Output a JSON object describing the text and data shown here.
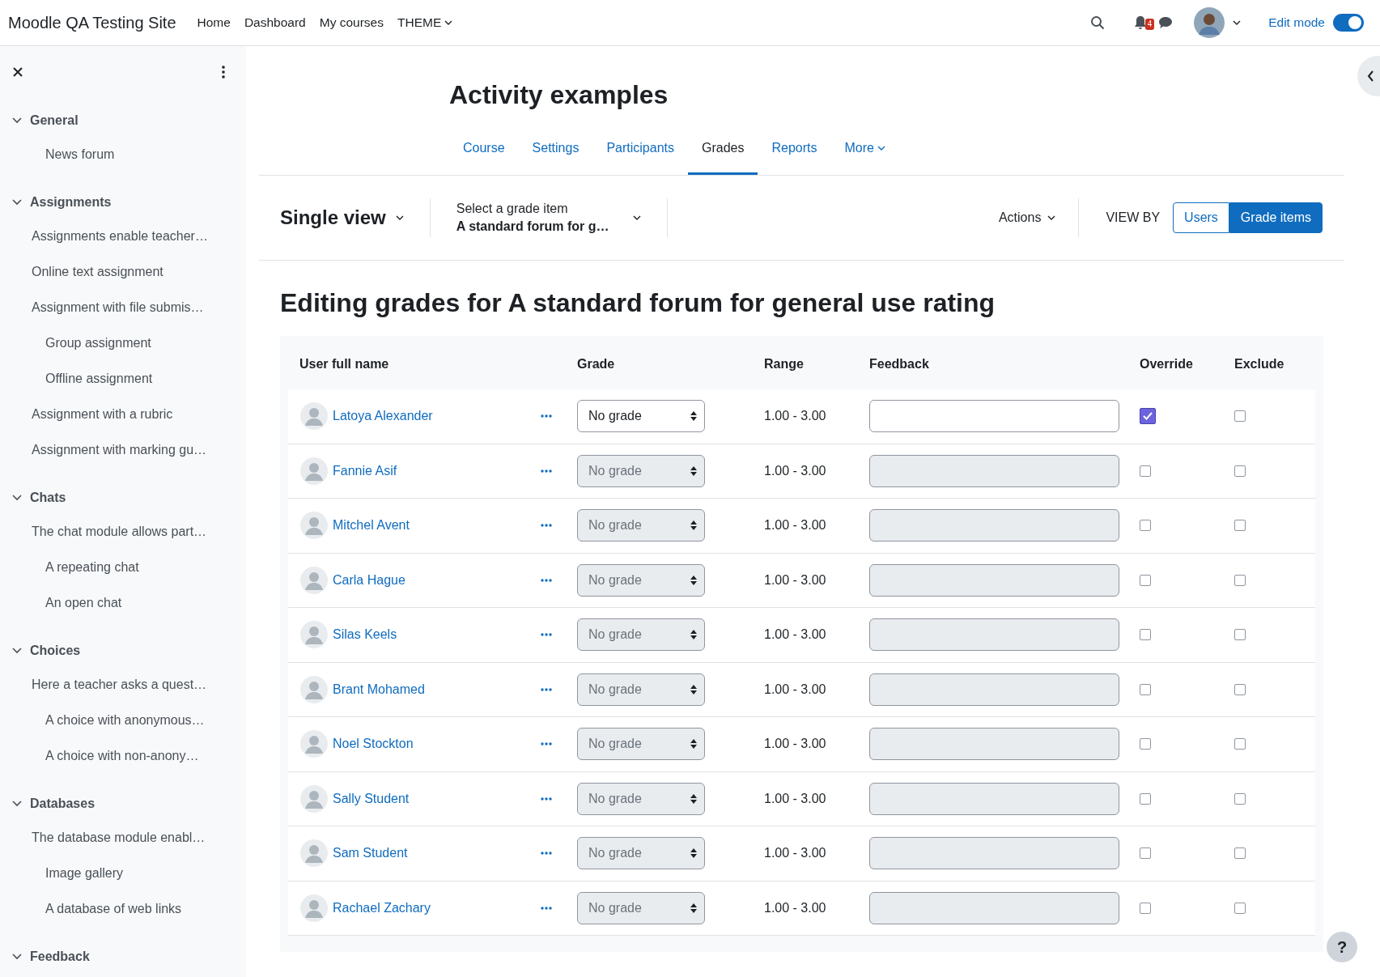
{
  "navbar": {
    "brand": "Moodle QA Testing Site",
    "links": [
      {
        "label": "Home",
        "dropdown": false
      },
      {
        "label": "Dashboard",
        "dropdown": false
      },
      {
        "label": "My courses",
        "dropdown": false
      },
      {
        "label": "THEME",
        "dropdown": true
      }
    ],
    "notification_count": "4",
    "edit_mode": {
      "label": "Edit mode",
      "on": true
    }
  },
  "sidebar": {
    "sections": [
      {
        "title": "General",
        "expanded": true,
        "items": [
          {
            "label": "News forum",
            "indented": true
          }
        ]
      },
      {
        "title": "Assignments",
        "expanded": true,
        "items": [
          {
            "label": "Assignments enable teacher…",
            "indented": false
          },
          {
            "label": "Online text assignment",
            "indented": false
          },
          {
            "label": "Assignment with file submis…",
            "indented": false
          },
          {
            "label": "Group assignment",
            "indented": true
          },
          {
            "label": "Offline assignment",
            "indented": true
          },
          {
            "label": "Assignment with a rubric",
            "indented": false
          },
          {
            "label": "Assignment with marking gu…",
            "indented": false
          }
        ]
      },
      {
        "title": "Chats",
        "expanded": true,
        "items": [
          {
            "label": "The chat module allows part…",
            "indented": false
          },
          {
            "label": "A repeating chat",
            "indented": true
          },
          {
            "label": "An open chat",
            "indented": true
          }
        ]
      },
      {
        "title": "Choices",
        "expanded": true,
        "items": [
          {
            "label": "Here a teacher asks a quest…",
            "indented": false
          },
          {
            "label": "A choice with anonymous…",
            "indented": true
          },
          {
            "label": "A choice with non-anony…",
            "indented": true
          }
        ]
      },
      {
        "title": "Databases",
        "expanded": true,
        "items": [
          {
            "label": "The database module enabl…",
            "indented": false
          },
          {
            "label": "Image gallery",
            "indented": true
          },
          {
            "label": "A database of web links",
            "indented": true
          }
        ]
      },
      {
        "title": "Feedback",
        "expanded": true
      }
    ]
  },
  "course": {
    "title": "Activity examples",
    "tabs": [
      {
        "label": "Course",
        "selected": false,
        "dropdown": false
      },
      {
        "label": "Settings",
        "selected": false,
        "dropdown": false
      },
      {
        "label": "Participants",
        "selected": false,
        "dropdown": false
      },
      {
        "label": "Grades",
        "selected": true,
        "dropdown": false
      },
      {
        "label": "Reports",
        "selected": false,
        "dropdown": false
      },
      {
        "label": "More",
        "selected": false,
        "dropdown": true
      }
    ]
  },
  "toolbar": {
    "report": "Single view",
    "grade_item_label": "Select a grade item",
    "grade_item_value": "A standard forum for g…",
    "actions": "Actions",
    "view_by_label": "VIEW BY",
    "view_by": [
      {
        "label": "Users",
        "selected": false
      },
      {
        "label": "Grade items",
        "selected": true
      }
    ]
  },
  "heading": "Editing grades for A standard forum for general use rating",
  "table": {
    "columns": [
      "User full name",
      "Grade",
      "Range",
      "Feedback",
      "Override",
      "Exclude"
    ],
    "rows": [
      {
        "name": "Latoya Alexander",
        "grade": "No grade",
        "range": "1.00 - 3.00",
        "override": true,
        "exclude": false
      },
      {
        "name": "Fannie Asif",
        "grade": "No grade",
        "range": "1.00 - 3.00",
        "override": false,
        "exclude": false
      },
      {
        "name": "Mitchel Avent",
        "grade": "No grade",
        "range": "1.00 - 3.00",
        "override": false,
        "exclude": false
      },
      {
        "name": "Carla Hague",
        "grade": "No grade",
        "range": "1.00 - 3.00",
        "override": false,
        "exclude": false
      },
      {
        "name": "Silas Keels",
        "grade": "No grade",
        "range": "1.00 - 3.00",
        "override": false,
        "exclude": false
      },
      {
        "name": "Brant Mohamed",
        "grade": "No grade",
        "range": "1.00 - 3.00",
        "override": false,
        "exclude": false
      },
      {
        "name": "Noel Stockton",
        "grade": "No grade",
        "range": "1.00 - 3.00",
        "override": false,
        "exclude": false
      },
      {
        "name": "Sally Student",
        "grade": "No grade",
        "range": "1.00 - 3.00",
        "override": false,
        "exclude": false
      },
      {
        "name": "Sam Student",
        "grade": "No grade",
        "range": "1.00 - 3.00",
        "override": false,
        "exclude": false
      },
      {
        "name": "Rachael Zachary",
        "grade": "No grade",
        "range": "1.00 - 3.00",
        "override": false,
        "exclude": false
      }
    ]
  },
  "help": "?"
}
